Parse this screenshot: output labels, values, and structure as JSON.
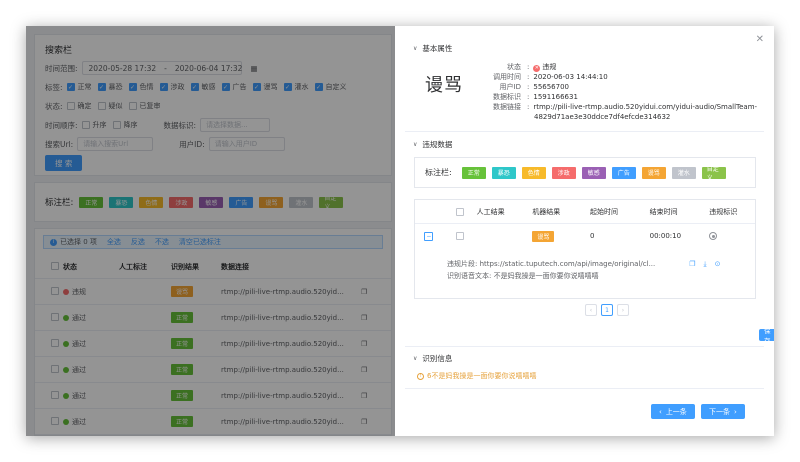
{
  "search": {
    "title": "搜索栏",
    "time_range_label": "时间范围:",
    "time_start": "2020-05-28 17:32",
    "time_sep": "-",
    "time_end": "2020-06-04 17:32",
    "tags_label": "标签:",
    "tags": [
      {
        "label": "正常",
        "checked": true
      },
      {
        "label": "暴恐",
        "checked": true
      },
      {
        "label": "色情",
        "checked": true
      },
      {
        "label": "涉政",
        "checked": true
      },
      {
        "label": "敏感",
        "checked": true
      },
      {
        "label": "广告",
        "checked": true
      },
      {
        "label": "谩骂",
        "checked": true
      },
      {
        "label": "灌水",
        "checked": true
      },
      {
        "label": "自定义",
        "checked": true
      }
    ],
    "status_label": "状态:",
    "statuses": [
      {
        "label": "确定",
        "checked": false
      },
      {
        "label": "疑似",
        "checked": false
      },
      {
        "label": "已复审",
        "checked": false
      }
    ],
    "order_label": "时间顺序:",
    "orders": [
      {
        "label": "升序",
        "checked": false
      },
      {
        "label": "降序",
        "checked": false
      }
    ],
    "data_id_label": "数据标识:",
    "data_id_placeholder": "请选择数据...",
    "url_label": "搜索Url:",
    "url_placeholder": "请输入搜索Url",
    "user_id_label": "用户ID:",
    "user_id_placeholder": "请输入用户ID",
    "search_button": "搜 索"
  },
  "label_bar": {
    "label": "标注栏:",
    "tags": [
      {
        "label": "正常",
        "color": "#67c23a"
      },
      {
        "label": "暴恐",
        "color": "#2ec7c9"
      },
      {
        "label": "色情",
        "color": "#f7ba2a"
      },
      {
        "label": "涉政",
        "color": "#f56c6c"
      },
      {
        "label": "敏感",
        "color": "#9a60b4"
      },
      {
        "label": "广告",
        "color": "#409eff"
      },
      {
        "label": "谩骂",
        "color": "#f4a534"
      },
      {
        "label": "灌水",
        "color": "#c0c4cc"
      },
      {
        "label": "自定义",
        "color": "#8bc34a"
      }
    ]
  },
  "list": {
    "selected_info": "已选择 0 项",
    "actions": [
      "全选",
      "反选",
      "不选",
      "清空已选标注"
    ],
    "headers": [
      "状态",
      "人工标注",
      "识别结果",
      "数据连接"
    ],
    "rows": [
      {
        "status": "违规",
        "status_color": "#f56c6c",
        "result": "谩骂",
        "result_color": "#f4a534",
        "link": "rtmp://pili-live-rtmp.audio.520yid..."
      },
      {
        "status": "通过",
        "status_color": "#67c23a",
        "result": "正常",
        "result_color": "#67c23a",
        "link": "rtmp://pili-live-rtmp.audio.520yid..."
      },
      {
        "status": "通过",
        "status_color": "#67c23a",
        "result": "正常",
        "result_color": "#67c23a",
        "link": "rtmp://pili-live-rtmp.audio.520yid..."
      },
      {
        "status": "通过",
        "status_color": "#67c23a",
        "result": "正常",
        "result_color": "#67c23a",
        "link": "rtmp://pili-live-rtmp.audio.520yid..."
      },
      {
        "status": "通过",
        "status_color": "#67c23a",
        "result": "正常",
        "result_color": "#67c23a",
        "link": "rtmp://pili-live-rtmp.audio.520yid..."
      },
      {
        "status": "通过",
        "status_color": "#67c23a",
        "result": "正常",
        "result_color": "#67c23a",
        "link": "rtmp://pili-live-rtmp.audio.520yid..."
      }
    ]
  },
  "drawer": {
    "basic_title": "基本属性",
    "big_label": "谩骂",
    "info": [
      {
        "k": "状态",
        "v": "违规"
      },
      {
        "k": "调用时间",
        "v": "2020-06-03 14:44:10"
      },
      {
        "k": "用户ID",
        "v": "55656700"
      },
      {
        "k": "数据标识",
        "v": "1591166631"
      },
      {
        "k": "数据链接",
        "v": "rtmp://pili-live-rtmp.audio.520yidui.com/yidui-audio/SmallTeam-"
      },
      {
        "k": "",
        "v": "4829d71ae3e30ddce7df4efcde314632"
      }
    ],
    "violation_title": "违规数据",
    "label_bar_label": "标注栏:",
    "table_headers": [
      "人工结果",
      "机器结果",
      "起始时间",
      "结束时间",
      "违规标识"
    ],
    "table_row": {
      "machine_result": "谩骂",
      "start": "0",
      "end": "00:00:10"
    },
    "clip_line": "违规片段: https://static.tuputech.com/api/image/original/cl...",
    "text_line": "识别语音文本: 不是妈我操是一面你要你说嘻嘻嘻",
    "page_prev": "‹",
    "page_current": "1",
    "page_next": "›",
    "save_button": "保 存",
    "recog_title": "识别信息",
    "recog_line": "6不是妈我操是一面你要你说嘻嘻嘻",
    "prev_button": "上一条",
    "next_button": "下一条"
  },
  "colors": {
    "primary": "#409eff",
    "danger": "#f56c6c",
    "success": "#67c23a",
    "warning": "#e6a23c"
  }
}
